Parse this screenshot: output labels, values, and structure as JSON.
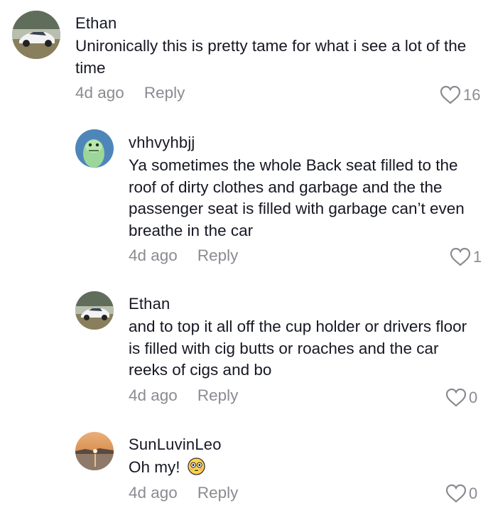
{
  "comments": [
    {
      "username": "Ethan",
      "text": "Unironically this is pretty tame for what i see a lot of the time",
      "time": "4d ago",
      "reply_label": "Reply",
      "likes": "16",
      "avatar": "car-photo-avatar"
    },
    {
      "username": "vhhvyhbjj",
      "text": "Ya sometimes the whole Back seat filled to the roof of dirty clothes and garbage and the the passenger seat is filled with garbage can’t even breathe in the car",
      "time": "4d ago",
      "reply_label": "Reply",
      "likes": "1",
      "avatar": "green-creature-avatar"
    },
    {
      "username": "Ethan",
      "text": "and to top it all off the cup holder or drivers floor is filled with cig butts or roaches and the car reeks of cigs and bo",
      "time": "4d ago",
      "reply_label": "Reply",
      "likes": "0",
      "avatar": "car-photo-avatar"
    },
    {
      "username": "SunLuvinLeo",
      "text": "Oh my!",
      "emoji": "flushed-face-emoji",
      "time": "4d ago",
      "reply_label": "Reply",
      "likes": "0",
      "avatar": "sunset-photo-avatar"
    }
  ],
  "colors": {
    "text": "#161823",
    "muted": "#8a8b91",
    "background": "#ffffff"
  }
}
